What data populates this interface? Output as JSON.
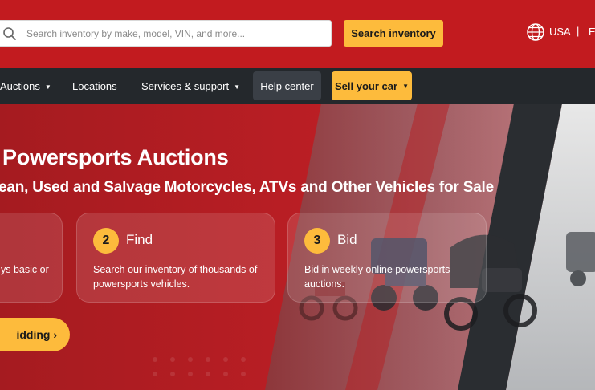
{
  "header": {
    "search": {
      "placeholder": "Search inventory by make, model, VIN, and more...",
      "button_label": "Search inventory"
    },
    "region": {
      "icon": "globe-icon",
      "label": "USA",
      "separator": "|",
      "language_label": "E"
    }
  },
  "nav": {
    "items": [
      {
        "label": "Auctions",
        "icon": "chevron-down-icon"
      },
      {
        "label": "Locations"
      },
      {
        "label": "Services & support",
        "icon": "chevron-down-icon"
      },
      {
        "label": "Help center"
      },
      {
        "label": "Sell your car",
        "icon": "chevron-down-icon"
      }
    ]
  },
  "hero": {
    "title": "Powersports Auctions",
    "subtitle": "ean, Used and Salvage Motorcycles, ATVs and Other Vehicles for Sale",
    "steps": [
      {
        "number": "",
        "title": "",
        "desc": "ys basic or"
      },
      {
        "number": "2",
        "title": "Find",
        "desc": "Search our inventory of thousands of powersports vehicles."
      },
      {
        "number": "3",
        "title": "Bid",
        "desc": "Bid in weekly online powersports auctions."
      }
    ],
    "cta_label": "idding ›"
  },
  "colors": {
    "header_red": "#c21b1f",
    "nav_dark": "#24282c",
    "accent_yellow": "#fdbb3c",
    "help_button": "#3a3f46"
  }
}
